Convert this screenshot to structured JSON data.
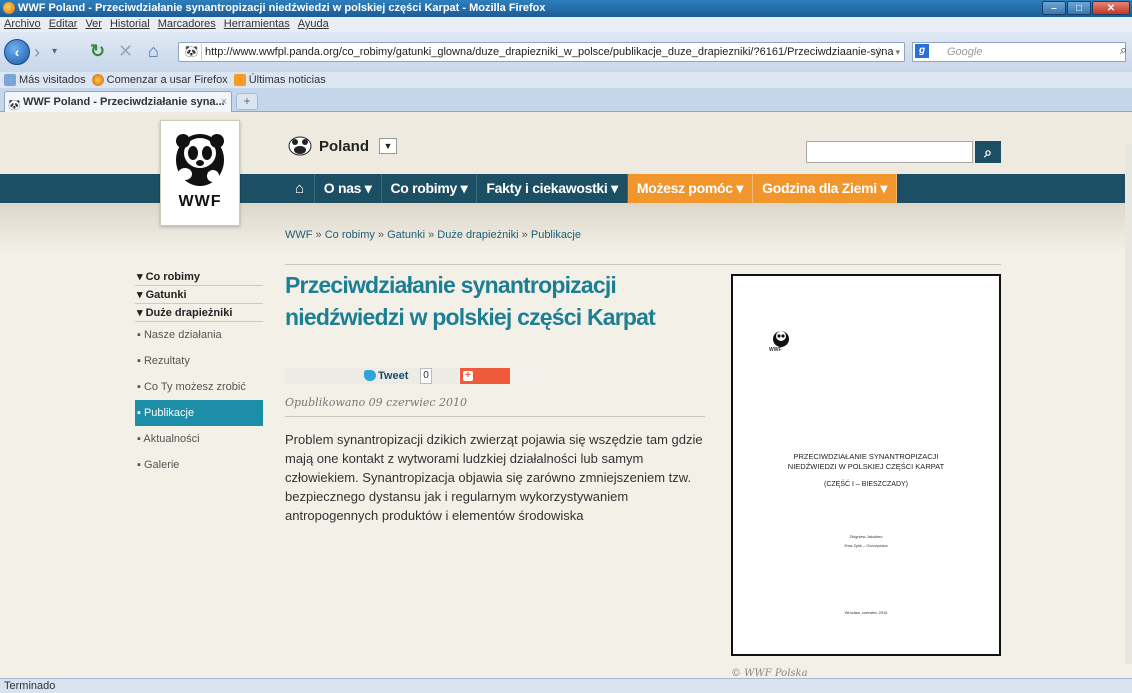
{
  "window": {
    "title": "WWF Poland - Przeciwdziałanie synantropizacji niedźwiedzi w polskiej części Karpat - Mozilla Firefox"
  },
  "menu": [
    "Archivo",
    "Editar",
    "Ver",
    "Historial",
    "Marcadores",
    "Herramientas",
    "Ayuda"
  ],
  "toolbar": {
    "url": "http://www.wwfpl.panda.org/co_robimy/gatunki_glowna/duze_drapiezniki_w_polsce/publikacje_duze_drapiezniki/?6161/Przeciwdziaanie-syna",
    "search_placeholder": "Google"
  },
  "bookmarks": [
    "Más visitados",
    "Comenzar a usar Firefox",
    "Últimas noticias"
  ],
  "tab": {
    "label": "WWF Poland - Przeciwdziałanie syna..."
  },
  "site": {
    "logo_text": "WWF",
    "country": "Poland",
    "nav": [
      "O nas ▾",
      "Co robimy ▾",
      "Fakty i ciekawostki ▾",
      "Możesz pomóc ▾",
      "Godzina dla Ziemi ▾"
    ],
    "breadcrumb": [
      "WWF",
      "Co robimy",
      "Gatunki",
      "Duże drapieżniki",
      "Publikacje"
    ],
    "breadcrumb_sep": "»"
  },
  "sidebar": {
    "headers": [
      "▾ Co robimy",
      "▾ Gatunki",
      "▾ Duże drapieżniki"
    ],
    "items": [
      "Nasze działania",
      "Rezultaty",
      "Co Ty możesz zrobić",
      "Publikacje",
      "Aktualności",
      "Galerie"
    ],
    "active_index": 3
  },
  "article": {
    "title": "Przeciwdziałanie synantropizacji niedźwiedzi w polskiej części Karpat",
    "tweet_label": "Tweet",
    "tweet_count": "0",
    "published": "Opublikowano 09 czerwiec 2010",
    "body": "Problem synantropizacji dzikich zwierząt pojawia się wszędzie tam gdzie mają one kontakt z wytworami ludzkiej działalności lub samym człowiekiem. Synantropizacja objawia się zarówno zmniejszeniem tzw. bezpiecznego dystansu jak i regularnym wykorzystywaniem antropogennych produktów i elementów środowiska"
  },
  "document": {
    "logo_text": "WWF",
    "title_line1": "PRZECIWDZIAŁANIE SYNANTROPIZACJI",
    "title_line2": "NIEDŹWIEDZI W POLSKIEJ CZĘŚCI KARPAT",
    "subtitle": "(CZĘŚĆ I – BIESZCZADY)",
    "author1": "Zbigniew Jakubiec",
    "author2": "Ewa Zyśk – Gorczyńska",
    "place_date": "Wrocław, czerwiec 2010"
  },
  "copyright": "© WWF Polska",
  "status": "Terminado",
  "colors": {
    "teal": "#1c4f64",
    "orange": "#f0962d",
    "title_teal": "#1c7f94",
    "active_side": "#1c8ea7"
  }
}
